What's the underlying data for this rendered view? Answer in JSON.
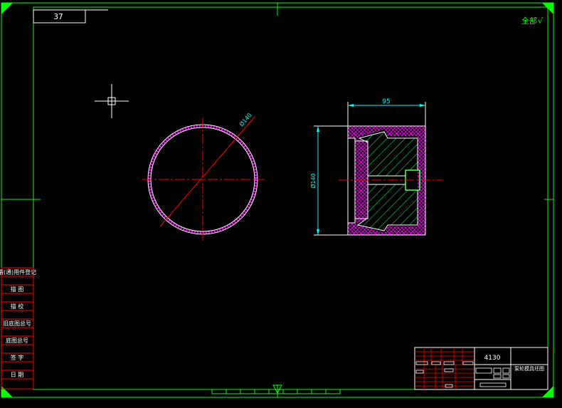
{
  "drawing": {
    "code_box": "37",
    "roughness_note": "全部",
    "roughness_symbol": "√",
    "part_number": "4130",
    "part_name": "泵轮模具坯图",
    "dim_width": "95",
    "dim_height": "Ø140",
    "dim_diameter": "Ø140"
  },
  "side_table": {
    "rows": [
      "借(通)用件登记",
      "描 图",
      "描 校",
      "旧底图总号",
      "底图总号",
      "签 字",
      "日 期"
    ]
  },
  "colors": {
    "frame": "#00ff00",
    "dim": "#00ffff",
    "center": "#ff0000",
    "outline": "#ffffff",
    "hatch_ring": "#ff00ff",
    "hatch_core": "#00ff80",
    "background": "#000000"
  }
}
